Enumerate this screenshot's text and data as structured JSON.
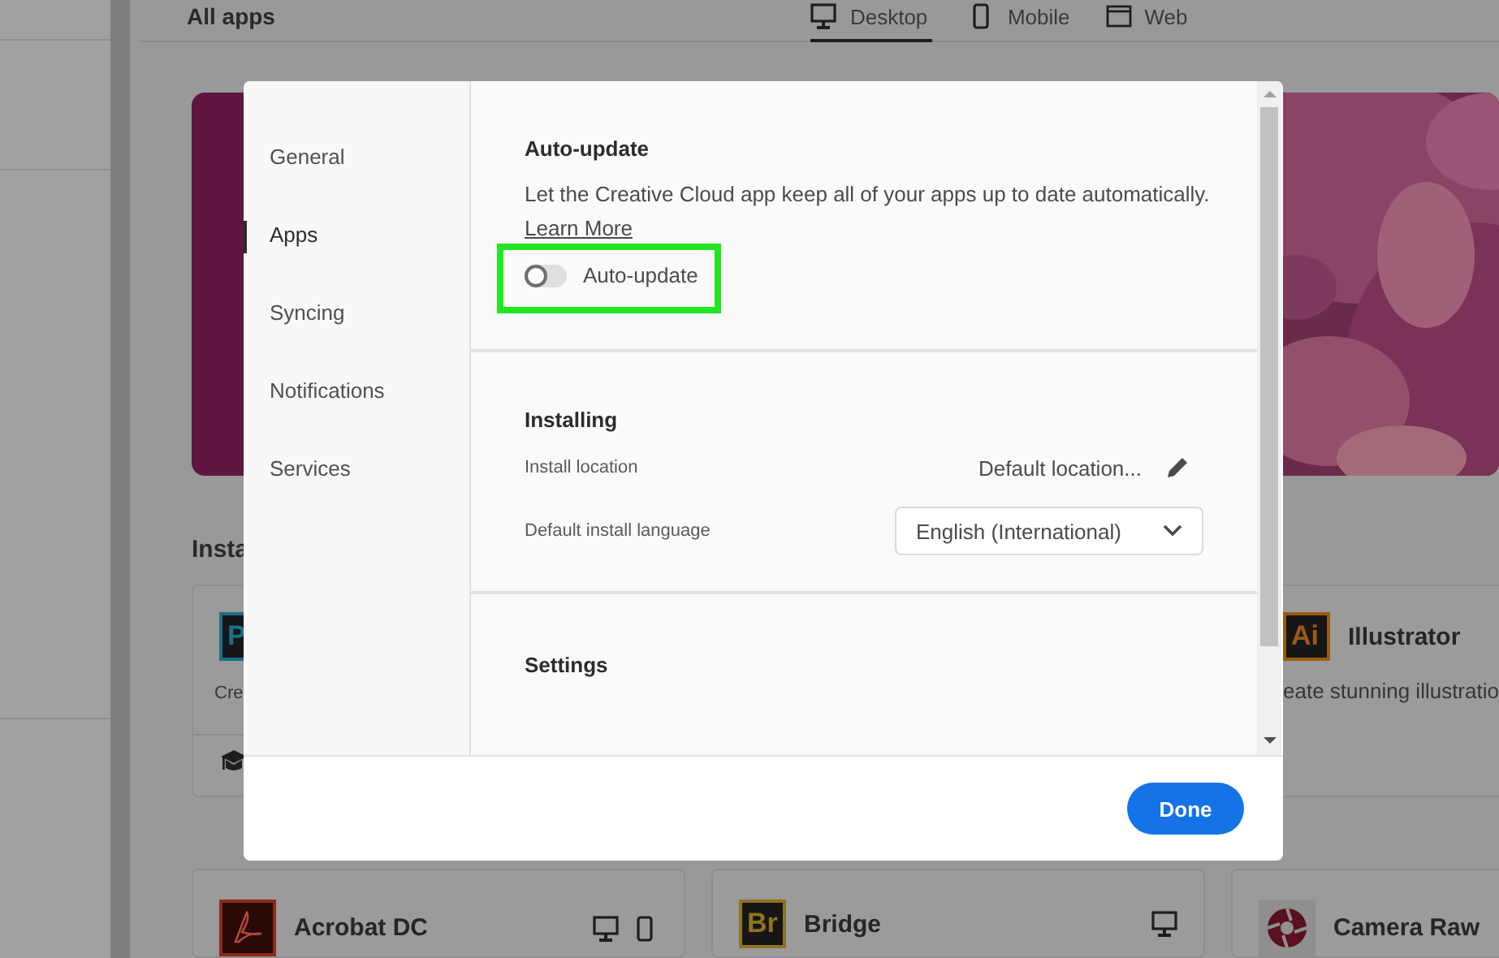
{
  "background": {
    "header": {
      "title": "All apps",
      "tabs": [
        {
          "label": "Desktop",
          "selected": true
        },
        {
          "label": "Mobile",
          "selected": false
        },
        {
          "label": "Web",
          "selected": false
        }
      ]
    },
    "section_title": "Insta",
    "top_cards": [
      {
        "kind": "letters",
        "badge": "P",
        "color": "#1d6f8a",
        "description": "Cre",
        "footer": true
      },
      {
        "kind": "letters",
        "badge": "Ai",
        "color": "#9a5a12",
        "name": "Illustrator",
        "description": "eate stunning illustratio",
        "footer": false
      }
    ],
    "bottom_cards": [
      {
        "kind": "acrobat",
        "color": "#8a2a1c",
        "name": "Acrobat DC",
        "on_desktop": true,
        "on_mobile": true
      },
      {
        "kind": "letters",
        "badge": "Br",
        "color": "#8d7420",
        "name": "Bridge",
        "on_desktop": true,
        "on_mobile": false
      },
      {
        "kind": "aperture",
        "color": "#5a1020",
        "name": "Camera Raw",
        "on_desktop": false,
        "on_mobile": false
      }
    ]
  },
  "dialog": {
    "nav": [
      {
        "label": "General",
        "selected": false
      },
      {
        "label": "Apps",
        "selected": true
      },
      {
        "label": "Syncing",
        "selected": false
      },
      {
        "label": "Notifications",
        "selected": false
      },
      {
        "label": "Services",
        "selected": false
      }
    ],
    "auto_update": {
      "title": "Auto-update",
      "description": "Let the Creative Cloud app keep all of your apps up to date automatically.",
      "link": "Learn More",
      "toggle": {
        "label": "Auto-update",
        "on": false,
        "highlighted": true
      }
    },
    "installing": {
      "title": "Installing",
      "rows": [
        {
          "kind": "value",
          "label": "Install location",
          "value": "Default location..."
        },
        {
          "kind": "select",
          "label": "Default install language",
          "value": "English (International)"
        }
      ]
    },
    "settings": {
      "title": "Settings"
    },
    "done_button": "Done"
  }
}
